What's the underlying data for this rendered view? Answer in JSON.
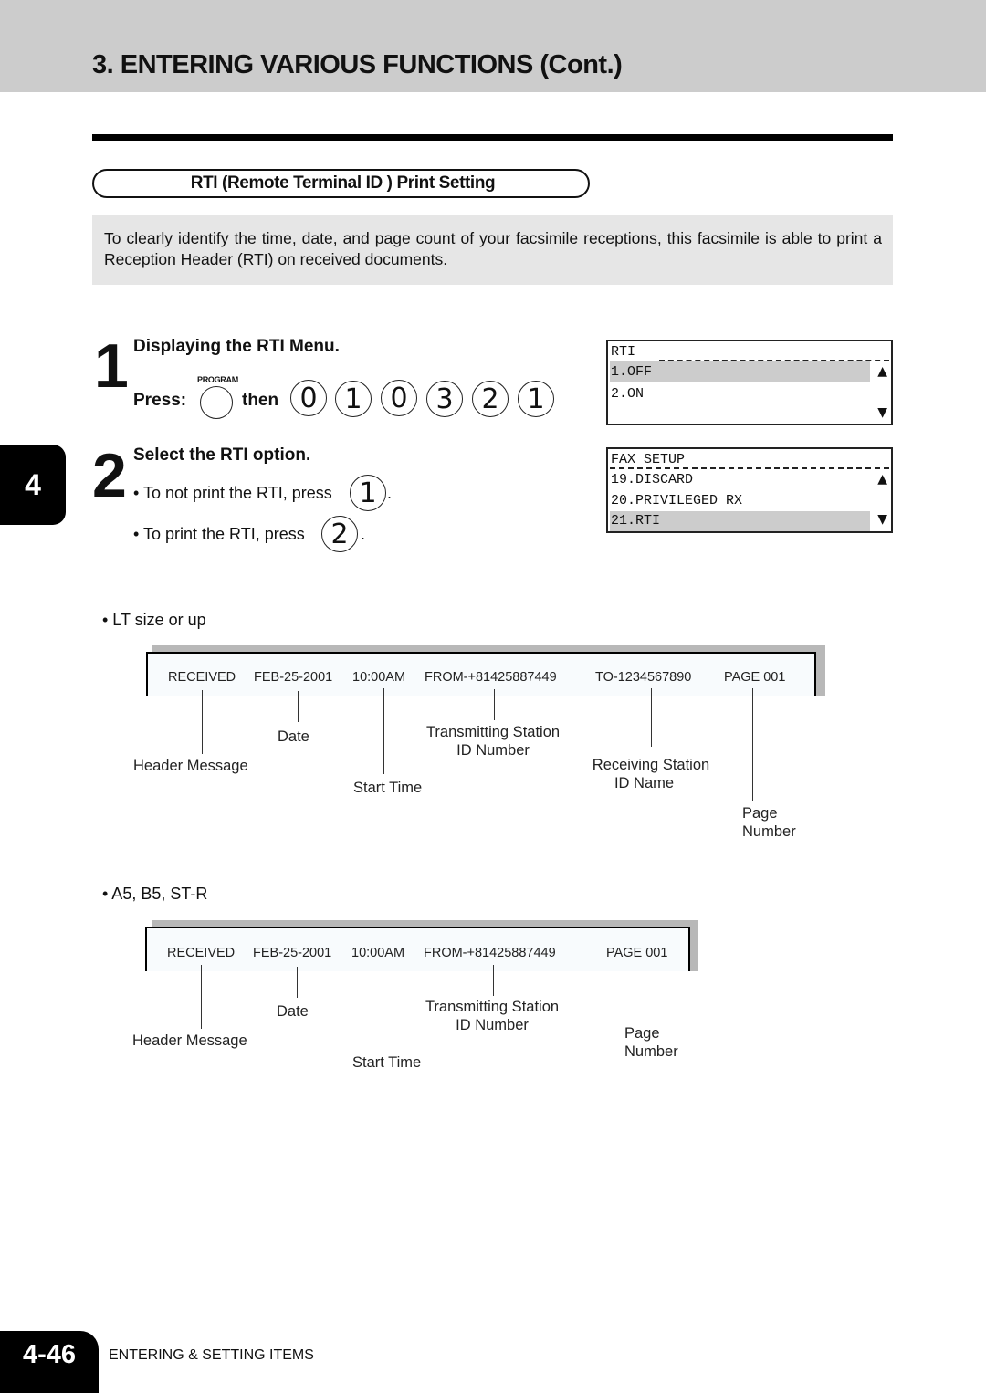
{
  "header": {
    "title": "3. ENTERING VARIOUS FUNCTIONS (Cont.)"
  },
  "section": {
    "title": "RTI (Remote Terminal ID ) Print Setting"
  },
  "intro": "To clearly identify the time, date, and page count of your facsimile receptions, this facsimile is able to print a Reception Header (RTI) on received documents.",
  "chapter_tab": "4",
  "step1": {
    "number": "1",
    "title": "Displaying the RTI Menu.",
    "press_label": "Press:",
    "program_key_caption": "PROGRAM",
    "then_label": "then",
    "keys": [
      "0",
      "1",
      "0",
      "3",
      "2",
      "1"
    ]
  },
  "step2": {
    "number": "2",
    "title": "Select the RTI option.",
    "bullets": [
      {
        "text": "• To not print the RTI, press",
        "key": "1",
        "suffix": "."
      },
      {
        "text": "• To print the RTI, press",
        "key": "2",
        "suffix": "."
      }
    ]
  },
  "lcd1": {
    "header": "RTI",
    "rows": [
      "1.OFF",
      "2.ON",
      ""
    ],
    "selected_index": 0,
    "arrow_up": "▲",
    "arrow_down": "▼"
  },
  "lcd2": {
    "header": "FAX SETUP",
    "rows": [
      "19.DISCARD",
      "20.PRIVILEGED RX",
      "21.RTI"
    ],
    "selected_index": 2,
    "arrow_up": "▲",
    "arrow_down": "▼"
  },
  "diagram_lt": {
    "label": "• LT size or up",
    "fields": [
      "RECEIVED",
      "FEB-25-2001",
      "10:00AM",
      "FROM-+81425887449",
      "TO-1234567890",
      "PAGE 001"
    ],
    "callouts": {
      "header_message": "Header Message",
      "date": "Date",
      "start_time": "Start Time",
      "tx_station_1": "Transmitting Station",
      "tx_station_2": "ID Number",
      "rx_station_1": "Receiving Station",
      "rx_station_2": "ID Name",
      "page_1": "Page",
      "page_2": "Number"
    }
  },
  "diagram_a5": {
    "label": "• A5, B5, ST-R",
    "fields": [
      "RECEIVED",
      "FEB-25-2001",
      "10:00AM",
      "FROM-+81425887449",
      "PAGE 001"
    ],
    "callouts": {
      "header_message": "Header Message",
      "date": "Date",
      "start_time": "Start Time",
      "tx_station_1": "Transmitting Station",
      "tx_station_2": "ID Number",
      "page_1": "Page",
      "page_2": "Number"
    }
  },
  "footer": {
    "page_number": "4-46",
    "section_label": "ENTERING & SETTING ITEMS"
  }
}
